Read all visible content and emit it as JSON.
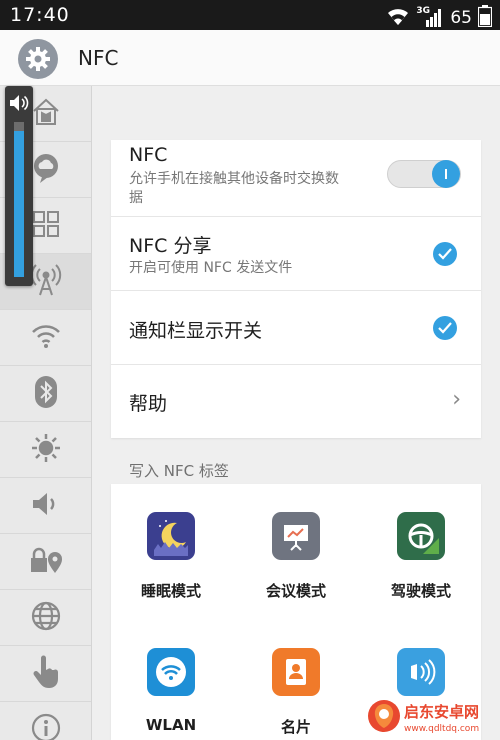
{
  "status_bar": {
    "time": "17:40",
    "network_type": "3G",
    "battery_level": "65"
  },
  "app_bar": {
    "title": "NFC"
  },
  "sidebar": {
    "items": [
      "home-shirt-icon",
      "cloud-chat-icon",
      "grid-icon",
      "nfc-signal-icon",
      "wifi-icon",
      "bluetooth-icon",
      "brightness-icon",
      "speaker-icon",
      "lock-location-icon",
      "globe-icon",
      "hand-pointer-icon",
      "info-icon"
    ],
    "selected_index": 3
  },
  "volume": {
    "level": 0.94
  },
  "settings": {
    "nfc": {
      "title": "NFC",
      "subtitle_line1": "允许手机在接触其他设备时交换数",
      "subtitle_line2": "据",
      "enabled": true
    },
    "nfc_share": {
      "title": "NFC 分享",
      "subtitle": "开启可使用 NFC 发送文件",
      "checked": true
    },
    "notification_toggle": {
      "title": "通知栏显示开关",
      "checked": true
    },
    "help": {
      "title": "帮助"
    }
  },
  "nfc_tags": {
    "section_label": "写入 NFC 标签",
    "tiles": [
      {
        "label": "睡眠模式",
        "icon": "moon-sleep-icon",
        "color": "#3b3f8f"
      },
      {
        "label": "会议模式",
        "icon": "meeting-board-icon",
        "color": "#6f7480"
      },
      {
        "label": "驾驶模式",
        "icon": "steering-wheel-icon",
        "color": "#2f6d4a"
      },
      {
        "label": "WLAN",
        "icon": "wlan-icon",
        "color": "#1e8fd6"
      },
      {
        "label": "名片",
        "icon": "contact-card-icon",
        "color": "#f07a2a"
      },
      {
        "label": "",
        "icon": "nfc-tag-icon",
        "color": "#3aa0e0"
      }
    ]
  },
  "watermark": {
    "text_cn": "启东安卓网",
    "text_url": "www.qdltdq.com"
  },
  "colors": {
    "accent": "#33a0e0",
    "status_bar_bg": "#1a1a1a"
  }
}
